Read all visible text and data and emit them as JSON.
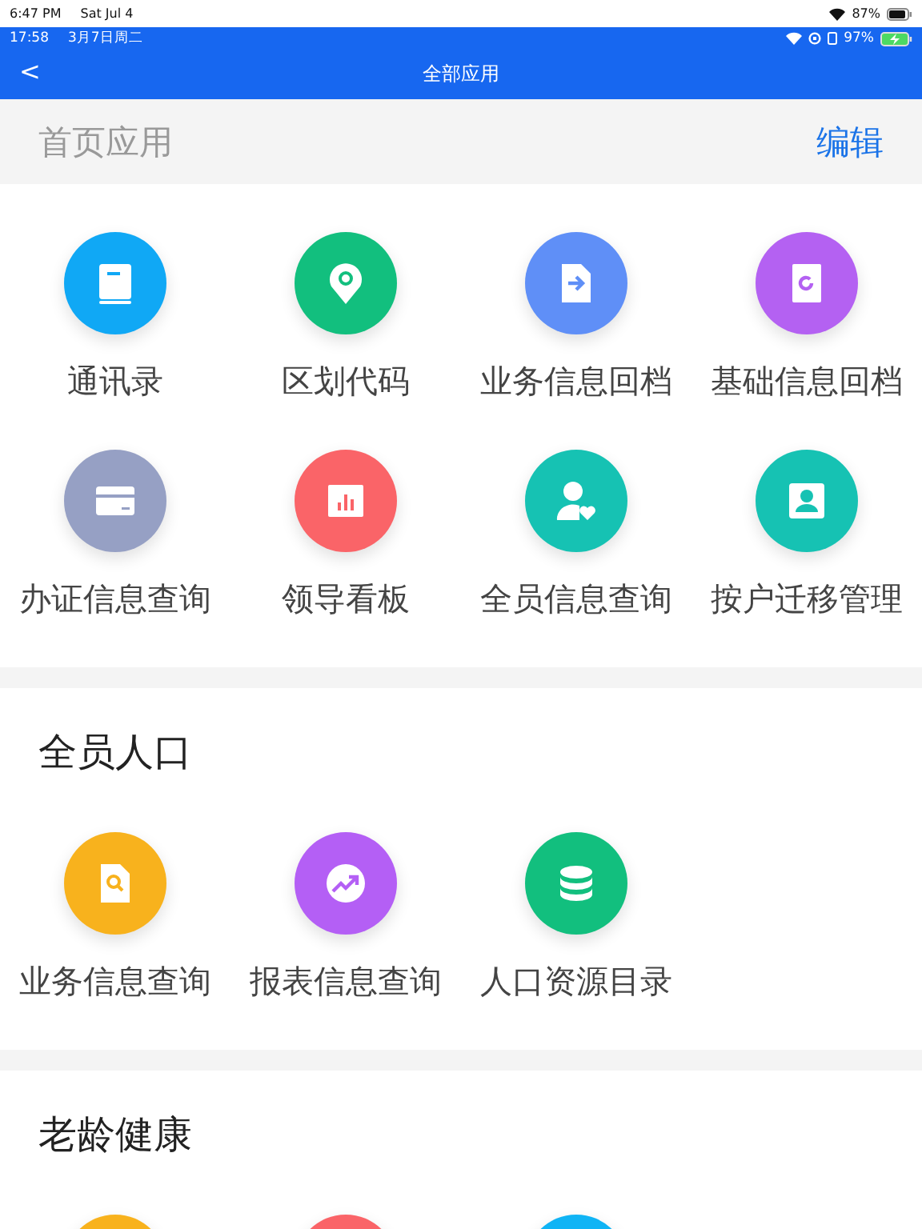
{
  "device_status": {
    "time": "6:47 PM",
    "date": "Sat Jul 4",
    "battery": "87%"
  },
  "app_status": {
    "time": "17:58",
    "date": "3月7日周二",
    "battery": "97%"
  },
  "nav": {
    "back": "<",
    "title": "全部应用"
  },
  "home_header": {
    "title": "首页应用",
    "action": "编辑"
  },
  "sections": [
    {
      "apps": [
        {
          "label": "通讯录",
          "kind": "book",
          "color": "#10a8f5"
        },
        {
          "label": "区划代码",
          "kind": "pin",
          "color": "#12bf7e"
        },
        {
          "label": "业务信息回档",
          "kind": "upload",
          "color": "#5f8ff7"
        },
        {
          "label": "基础信息回档",
          "kind": "refresh",
          "color": "#b461f2"
        },
        {
          "label": "办证信息查询",
          "kind": "card",
          "color": "#96a0c4"
        },
        {
          "label": "领导看板",
          "kind": "chart",
          "color": "#fa6468"
        },
        {
          "label": "全员信息查询",
          "kind": "person",
          "color": "#16c2b3"
        },
        {
          "label": "按户迁移管理",
          "kind": "contact",
          "color": "#16c2b3"
        }
      ]
    },
    {
      "title": "全员人口",
      "apps": [
        {
          "label": "业务信息查询",
          "kind": "search",
          "color": "#f8b21d"
        },
        {
          "label": "报表信息查询",
          "kind": "trend",
          "color": "#b45ff5"
        },
        {
          "label": "人口资源目录",
          "kind": "database",
          "color": "#12bf7e"
        }
      ]
    },
    {
      "title": "老龄健康",
      "apps": [
        {
          "kind": "blank",
          "color": "#f8b21d"
        },
        {
          "kind": "blank",
          "color": "#fa6468"
        },
        {
          "kind": "blank",
          "color": "#10b4f5"
        }
      ]
    }
  ]
}
